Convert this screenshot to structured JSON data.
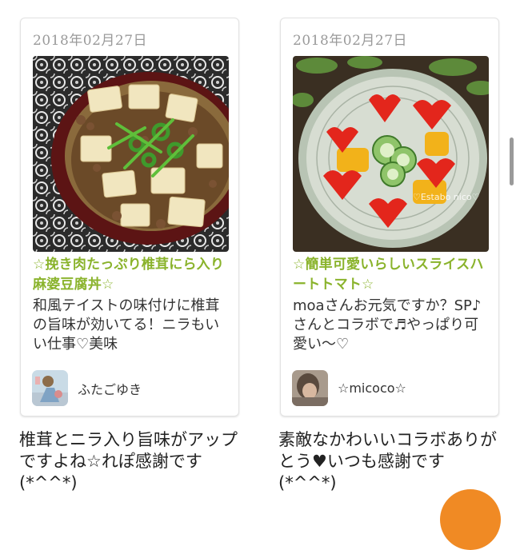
{
  "cards": [
    {
      "date": "2018年02月27日",
      "title": "☆挽き肉たっぷり椎茸にら入り麻婆豆腐丼☆",
      "description": "和風テイストの味付けに椎茸の旨味が効いてる！ニラもいい仕事♡美味",
      "author": "ふたごゆき",
      "comment": "椎茸とニラ入り旨味がアップですよね☆れぽ感謝です(*^^*)"
    },
    {
      "date": "2018年02月27日",
      "title": "☆簡単可愛いらしいスライスハートトマト☆",
      "description": "moaさんお元気ですか？SP♪さんとコラボで♬やっぱり可愛い～♡",
      "author": "☆micoco☆",
      "photo_watermark": "♡Estabo nico♡",
      "comment": "素敵なかわいいコラボありがとう♥いつも感謝です(*^^*)"
    }
  ],
  "colors": {
    "title": "#8ab32c",
    "date": "#9a9a9a",
    "fab": "#f08a24"
  }
}
